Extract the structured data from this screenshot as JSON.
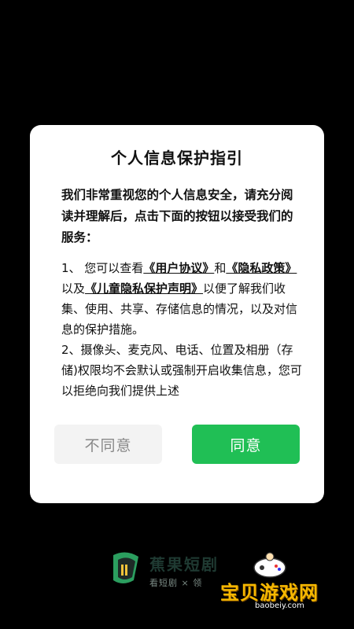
{
  "dialog": {
    "title": "个人信息保护指引",
    "intro": "我们非常重视您的个人信息安全，请充分阅读并理解后，点击下面的按钮以接受我们的服务：",
    "item1": {
      "prefix": "1、 您可以查看",
      "link1": "《用户协议》",
      "and": "和",
      "link2": "《隐私政策》",
      "and2": "以及",
      "link3": "《儿童隐私保护声明》",
      "rest": "以便了解我们收集、使用、共享、存储信息的情况，以及对信息的保护措施。"
    },
    "item2": "2、摄像头、麦克风、电话、位置及相册（存储)权限均不会默认或强制开启收集信息，您可以拒绝向我们提供上述",
    "disagree_label": "不同意",
    "agree_label": "同意"
  },
  "brand": {
    "name": "蕉果短剧",
    "slogan": "看短剧 × 领"
  },
  "watermark": {
    "text": "宝贝游戏网",
    "url": "baobeiy.com"
  },
  "colors": {
    "background": "#000000",
    "agree_button": "#20bf55",
    "disagree_button": "#f3f3f3",
    "watermark": "#f6b800"
  }
}
